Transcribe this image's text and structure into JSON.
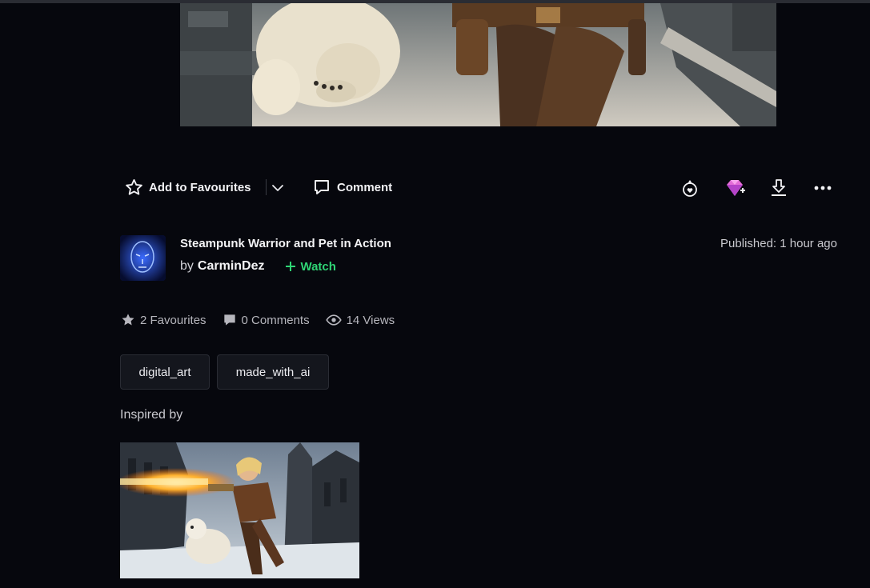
{
  "actions": {
    "favourite_label": "Add to Favourites",
    "comment_label": "Comment"
  },
  "deviation": {
    "title": "Steampunk Warrior and Pet in Action",
    "by_prefix": "by",
    "author": "CarminDez",
    "watch_label": "Watch",
    "published": "Published: 1 hour ago"
  },
  "stats": {
    "favourites": "2 Favourites",
    "comments": "0 Comments",
    "views": "14 Views"
  },
  "tags": [
    "digital_art",
    "made_with_ai"
  ],
  "inspired_label": "Inspired by",
  "icons": {
    "favourite": "star-outline-icon",
    "dropdown": "chevron-down-icon",
    "comment": "speech-bubble-icon",
    "badge": "badge-heart-icon",
    "core": "core-gem-icon",
    "download": "download-icon",
    "more": "more-dots-icon"
  },
  "colors": {
    "background": "#06070d",
    "accent_green": "#2fd575",
    "gem_pink": "#e46cd8"
  }
}
